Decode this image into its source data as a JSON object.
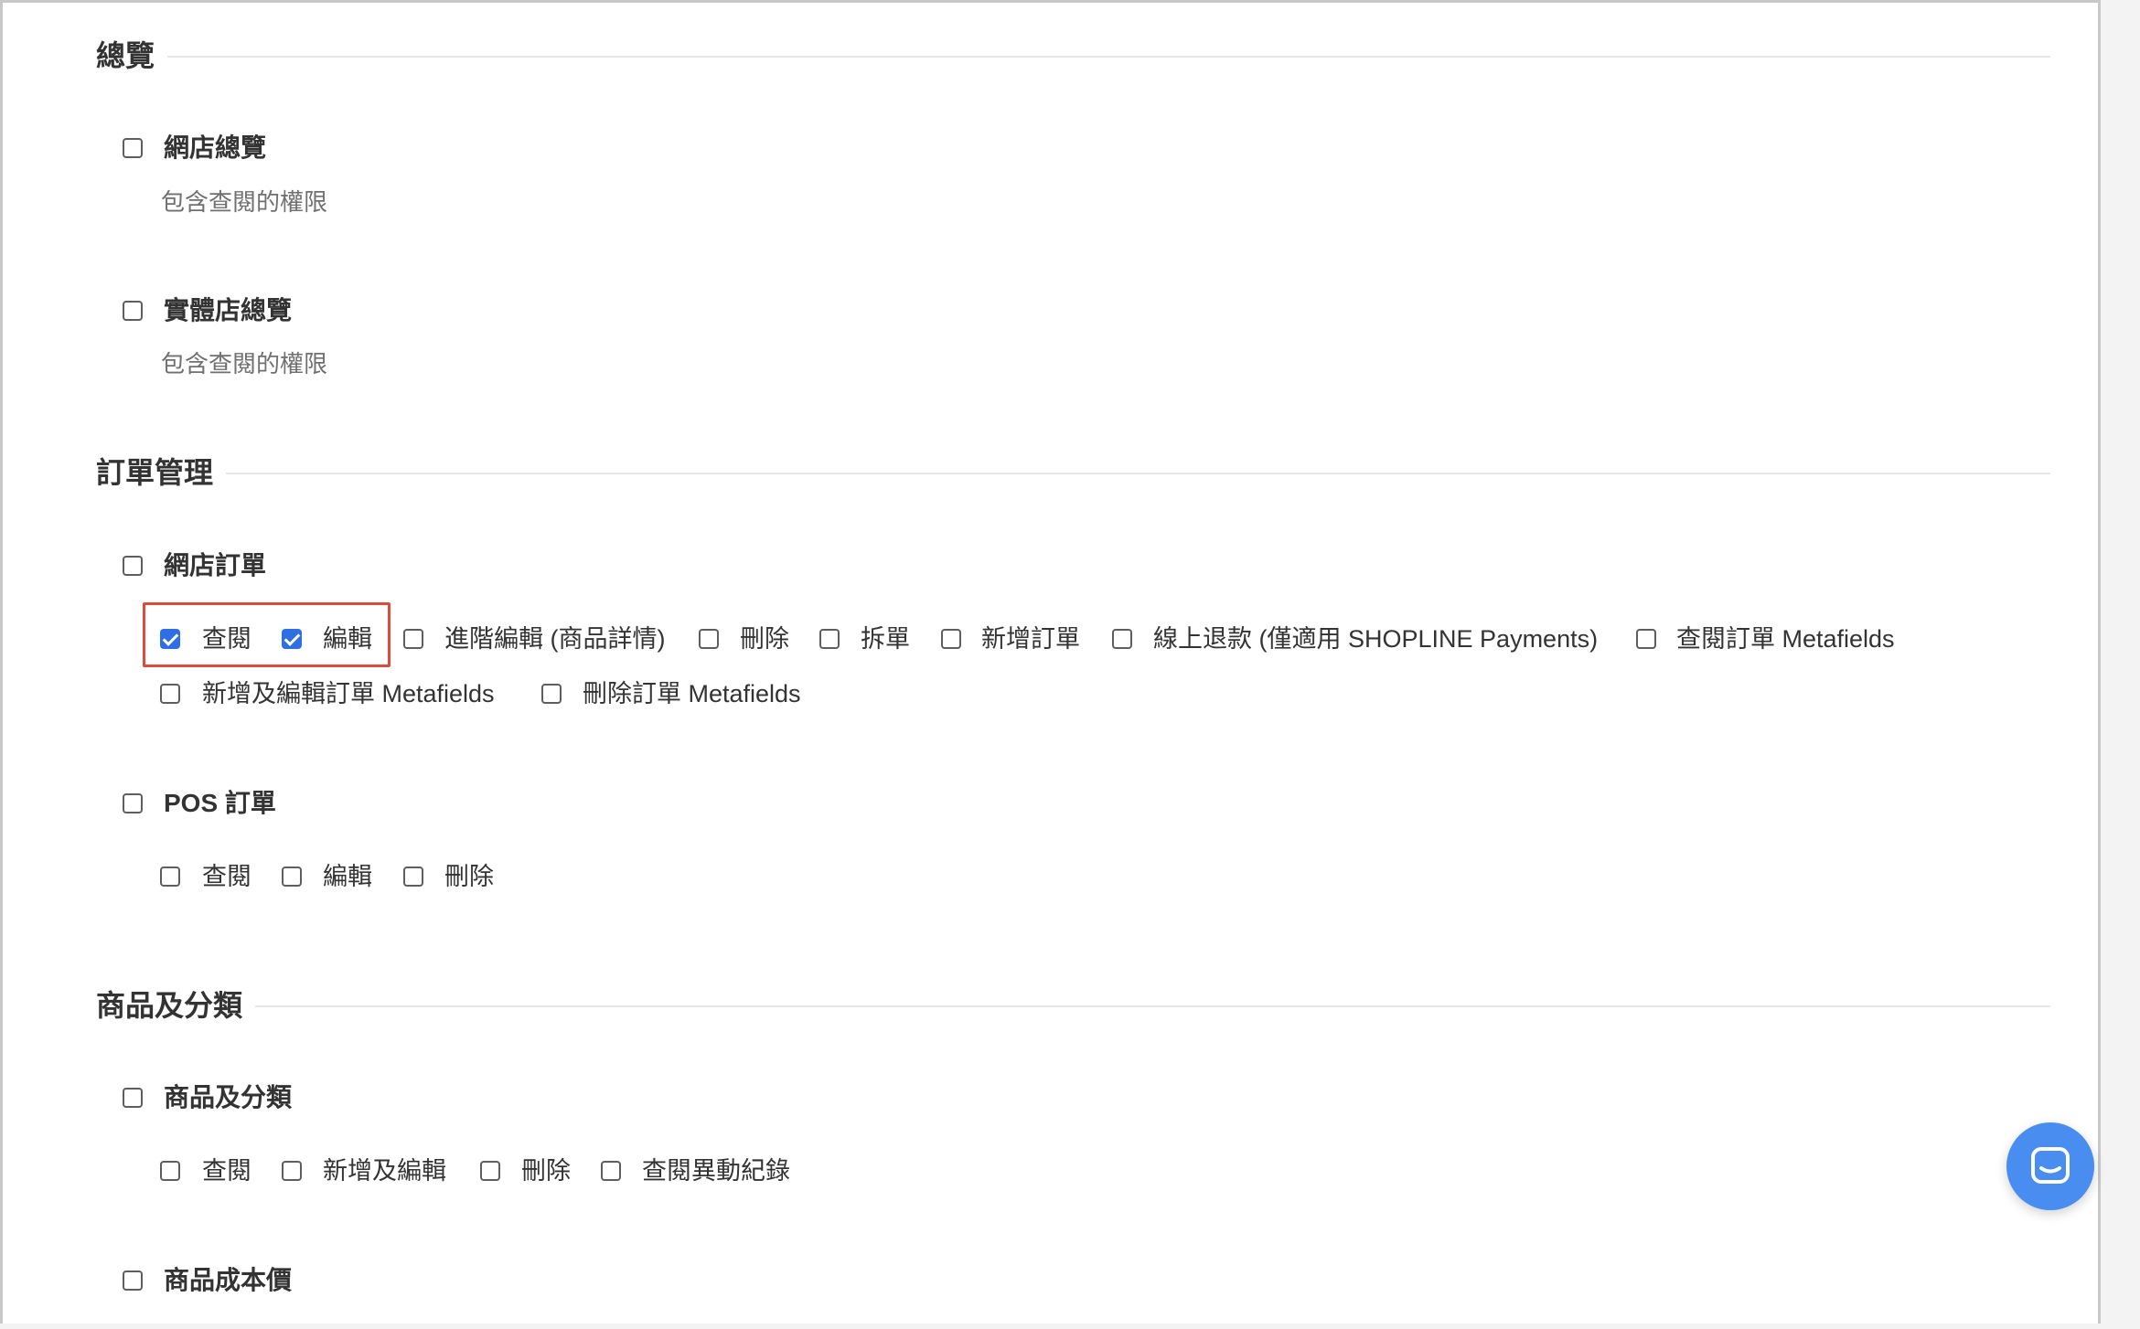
{
  "sections": {
    "overview": {
      "title": "總覽",
      "items": {
        "online_store_overview": {
          "label": "網店總覽",
          "desc": "包含查閱的權限"
        },
        "retail_store_overview": {
          "label": "實體店總覽",
          "desc": "包含查閱的權限"
        }
      }
    },
    "orders": {
      "title": "訂單管理",
      "items": {
        "online_orders": {
          "label": "網店訂單",
          "options": [
            {
              "label": "查閱",
              "checked": true
            },
            {
              "label": "編輯",
              "checked": true
            },
            {
              "label": "進階編輯 (商品詳情)",
              "checked": false
            },
            {
              "label": "刪除",
              "checked": false
            },
            {
              "label": "拆單",
              "checked": false
            },
            {
              "label": "新增訂單",
              "checked": false
            },
            {
              "label": "線上退款 (僅適用 SHOPLINE Payments)",
              "checked": false
            },
            {
              "label": "查閱訂單 Metafields",
              "checked": false
            },
            {
              "label": "新增及編輯訂單 Metafields",
              "checked": false
            },
            {
              "label": "刪除訂單 Metafields",
              "checked": false
            }
          ]
        },
        "pos_orders": {
          "label": "POS 訂單",
          "options": [
            {
              "label": "查閱",
              "checked": false
            },
            {
              "label": "編輯",
              "checked": false
            },
            {
              "label": "刪除",
              "checked": false
            }
          ]
        }
      }
    },
    "products": {
      "title": "商品及分類",
      "items": {
        "products_categories": {
          "label": "商品及分類",
          "options": [
            {
              "label": "查閱",
              "checked": false
            },
            {
              "label": "新增及編輯",
              "checked": false
            },
            {
              "label": "刪除",
              "checked": false
            },
            {
              "label": "查閱異動紀錄",
              "checked": false
            }
          ]
        },
        "product_cost": {
          "label": "商品成本價"
        }
      }
    }
  },
  "icons": {
    "chat": "chat-bubble-icon"
  },
  "colors": {
    "checkbox_checked": "#2f6fe4",
    "highlight": "#e04a3a",
    "chat_button": "#4a8df0"
  }
}
